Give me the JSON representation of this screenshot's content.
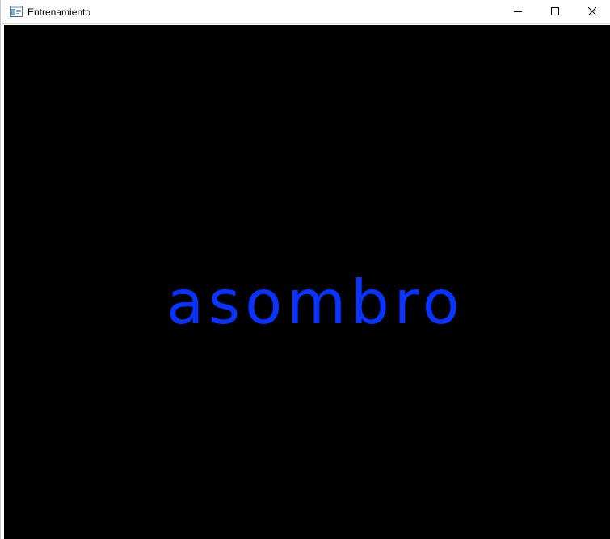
{
  "window": {
    "title": "Entrenamiento",
    "icon": "app-window-icon",
    "controls": {
      "minimize_icon": "minimize-icon",
      "maximize_icon": "maximize-icon",
      "close_icon": "close-icon"
    }
  },
  "canvas": {
    "background": "#000000",
    "word": "asombro",
    "word_color": "#0b33ff"
  }
}
